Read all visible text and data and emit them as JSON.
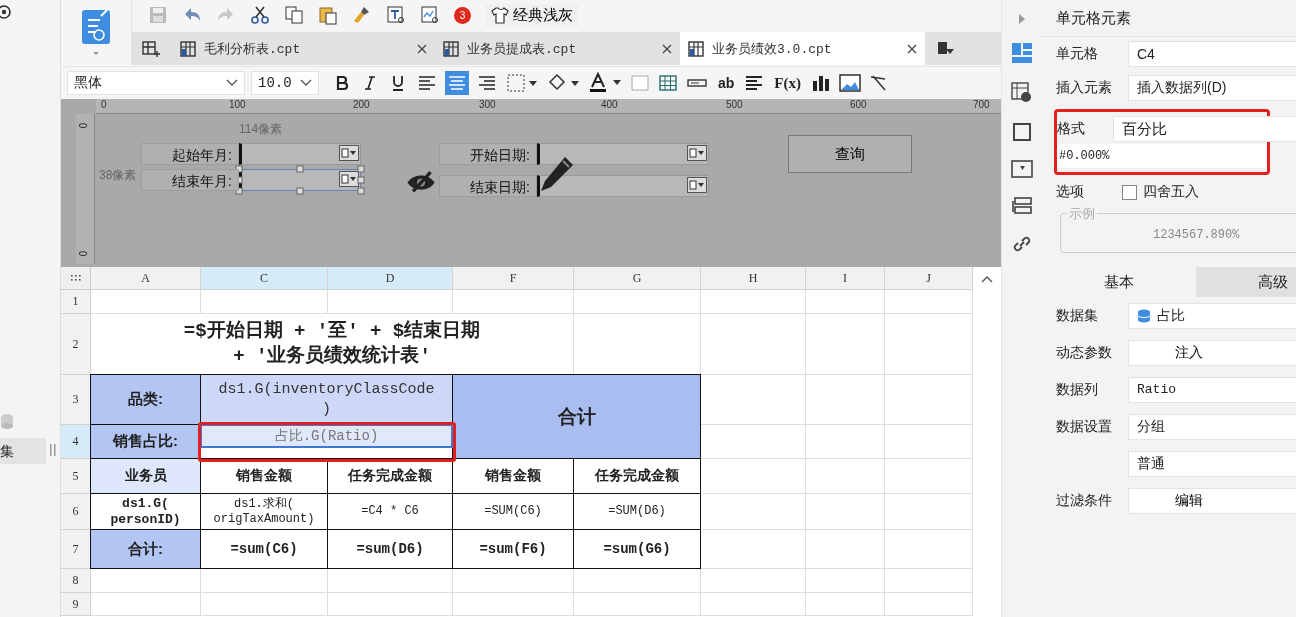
{
  "left_panel": {
    "item": "集"
  },
  "toolbar": {
    "badge": "3",
    "theme": "经典浅灰"
  },
  "tabs": [
    {
      "label": "毛利分析表.cpt",
      "selected": false
    },
    {
      "label": "业务员提成表.cpt",
      "selected": false
    },
    {
      "label": "业务员绩效3.0.cpt",
      "selected": true
    }
  ],
  "format_bar": {
    "font": "黑体",
    "size": "10.0",
    "bold": false,
    "italic": false,
    "underline": false,
    "alignments": [
      {
        "kind": "left",
        "selected": false
      },
      {
        "kind": "center",
        "selected": true
      },
      {
        "kind": "right",
        "selected": false
      }
    ],
    "text_tools": [
      "ab",
      "F(x)"
    ]
  },
  "parameter_pane": {
    "ruler": [
      "0",
      "100",
      "200",
      "300",
      "400",
      "500",
      "600",
      "700"
    ],
    "vertical_ruler": [
      "0",
      "0"
    ],
    "measures": [
      "114像素",
      "38像素"
    ],
    "widgets": [
      {
        "kind": "label",
        "text": "起始年月:"
      },
      {
        "kind": "field",
        "selected": false
      },
      {
        "kind": "label",
        "text": "结束年月:"
      },
      {
        "kind": "field",
        "selected": true
      },
      {
        "kind": "label",
        "text": "开始日期:"
      },
      {
        "kind": "field",
        "selected": false
      },
      {
        "kind": "label",
        "text": "结束日期:"
      },
      {
        "kind": "field",
        "selected": false
      },
      {
        "kind": "button",
        "text": "查询"
      }
    ]
  },
  "sheet": {
    "selection_marked": true,
    "columns": [
      {
        "label": "A",
        "selected": false
      },
      {
        "label": "C",
        "selected": true
      },
      {
        "label": "D",
        "selected": true
      },
      {
        "label": "F",
        "selected": false
      },
      {
        "label": "G",
        "selected": false
      },
      {
        "label": "H",
        "selected": false
      },
      {
        "label": "I",
        "selected": false
      },
      {
        "label": "J",
        "selected": false
      }
    ],
    "rows": [
      {
        "number": "1",
        "selected": false
      },
      {
        "number": "2",
        "selected": false,
        "cells": [
          {
            "kind": "title",
            "text": "=$开始日期 + '至' + $结束日期\n+ '业务员绩效统计表'",
            "selected": false
          }
        ]
      },
      {
        "number": "3",
        "selected": false,
        "cells": [
          {
            "kind": "label",
            "text": "品类:",
            "color": "#b3c5f3",
            "selected": false
          },
          {
            "kind": "reference",
            "text": "ds1.G(inventoryClassCode\n)",
            "color": "#cdd8f8",
            "selected": false
          },
          {
            "kind": "total-label",
            "text": "合计",
            "color": "#a9bdf1",
            "selected": false
          }
        ]
      },
      {
        "number": "4",
        "selected": true,
        "cells": [
          {
            "kind": "label",
            "text": "销售占比:",
            "color": "#b3c5f3",
            "selected": false
          },
          {
            "kind": "reference",
            "text": "占比.G(Ratio)",
            "color": "#e1e8fb",
            "selected": true
          }
        ]
      },
      {
        "number": "5",
        "selected": false,
        "cells": [
          {
            "kind": "heading",
            "text": "业务员",
            "color": "#dfe7fc",
            "selected": false
          },
          {
            "kind": "heading",
            "text": "销售金额",
            "selected": false
          },
          {
            "kind": "heading",
            "text": "任务完成金额",
            "selected": false
          },
          {
            "kind": "heading",
            "text": "销售金额",
            "selected": false
          },
          {
            "kind": "heading",
            "text": "任务完成金额",
            "selected": false
          }
        ]
      },
      {
        "number": "6",
        "selected": false,
        "cells": [
          {
            "kind": "group",
            "text": "ds1.G(\npersonID)",
            "selected": false
          },
          {
            "kind": "expression",
            "text": "ds1.求和(\norigTaxAmount)",
            "selected": false
          },
          {
            "kind": "expression",
            "text": "=C4 * C6",
            "selected": false
          },
          {
            "kind": "expression",
            "text": "=SUM(C6)",
            "selected": false
          },
          {
            "kind": "expression",
            "text": "=SUM(D6)",
            "selected": false
          }
        ]
      },
      {
        "number": "7",
        "selected": false,
        "cells": [
          {
            "kind": "label",
            "text": "合计:",
            "color": "#b3c5f3",
            "selected": false
          },
          {
            "kind": "total",
            "text": "=sum(C6)",
            "selected": false
          },
          {
            "kind": "total",
            "text": "=sum(D6)",
            "selected": false
          },
          {
            "kind": "total",
            "text": "=sum(F6)",
            "selected": false
          },
          {
            "kind": "total",
            "text": "=sum(G6)",
            "selected": false
          }
        ]
      },
      {
        "number": "8",
        "selected": false
      },
      {
        "number": "9",
        "selected": false
      }
    ]
  },
  "properties": {
    "title": "单元格元素",
    "cell": {
      "label": "单元格",
      "value": "C4"
    },
    "insert": {
      "label": "插入元素",
      "value": "插入数据列(D)"
    },
    "format": {
      "label": "格式",
      "value": "百分比",
      "pattern": "#0.000%",
      "marked": true
    },
    "options": {
      "label": "选项",
      "checkbox": "四舍五入",
      "checked": false
    },
    "example": {
      "legend": "示例",
      "value": "1234567.890%"
    },
    "tabs": [
      {
        "label": "基本",
        "selected": true
      },
      {
        "label": "高级",
        "selected": false
      }
    ],
    "fields": [
      {
        "kind": "dataset",
        "label": "数据集",
        "value": "占比"
      },
      {
        "kind": "button",
        "label": "动态参数",
        "value": "注入"
      },
      {
        "kind": "text",
        "label": "数据列",
        "value": "Ratio"
      },
      {
        "kind": "select",
        "label": "数据设置",
        "value": "分组"
      },
      {
        "kind": "select",
        "value": "普通"
      },
      {
        "kind": "button",
        "label": "过滤条件",
        "value": "编辑"
      }
    ]
  }
}
